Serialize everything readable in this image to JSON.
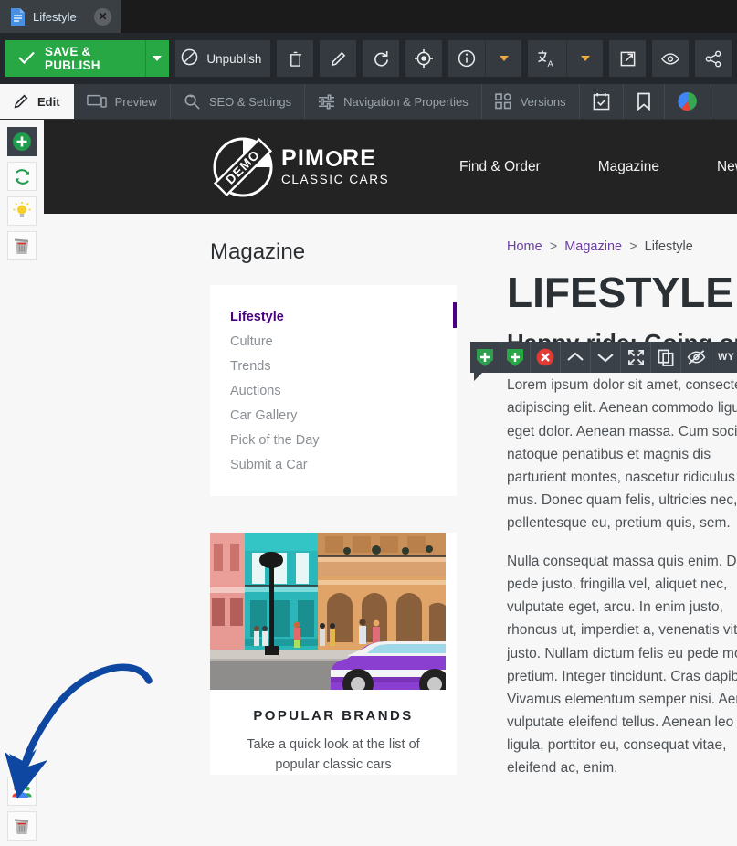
{
  "window": {
    "tab": {
      "label": "Lifestyle",
      "icon": "document-icon",
      "close_icon": "close-icon"
    }
  },
  "toolbar": {
    "save_label": "SAVE & PUBLISH",
    "save_dropdown_icon": "chevron-down-icon",
    "unpublish_label": "Unpublish",
    "buttons": [
      {
        "name": "delete-button",
        "icon": "trash-icon"
      },
      {
        "name": "rename-button",
        "icon": "pencil-icon"
      },
      {
        "name": "reload-button",
        "icon": "refresh-icon"
      },
      {
        "name": "locate-button",
        "icon": "target-icon"
      },
      {
        "name": "info-button",
        "icon": "info-icon"
      },
      {
        "name": "info-dropdown-button",
        "icon": "caret-down-icon"
      },
      {
        "name": "translate-button",
        "icon": "translate-icon"
      },
      {
        "name": "translate-dropdown-button",
        "icon": "caret-down-icon"
      },
      {
        "name": "open-in-new-window-button",
        "icon": "external-link-icon"
      },
      {
        "name": "preview-button",
        "icon": "eye-icon"
      },
      {
        "name": "share-button",
        "icon": "share-icon"
      }
    ]
  },
  "tabs": [
    {
      "label": "Edit",
      "icon": "pencil-icon",
      "active": true
    },
    {
      "label": "Preview",
      "icon": "devices-icon",
      "active": false
    },
    {
      "label": "SEO & Settings",
      "icon": "search-settings-icon",
      "active": false
    },
    {
      "label": "Navigation & Properties",
      "icon": "sliders-icon",
      "active": false
    },
    {
      "label": "Versions",
      "icon": "grid-icon",
      "active": false
    },
    {
      "label": "",
      "icon": "calendar-check-icon",
      "active": false
    },
    {
      "label": "",
      "icon": "bookmark-icon",
      "active": false
    },
    {
      "label": "",
      "icon": "pie-chart-icon",
      "active": false
    }
  ],
  "rail": {
    "top_items": [
      {
        "name": "add-element-button",
        "icon": "plus-circle-icon",
        "state": "dark"
      },
      {
        "name": "reload-element-button",
        "icon": "refresh-green-icon",
        "state": "light"
      },
      {
        "name": "hint-button",
        "icon": "lightbulb-icon",
        "state": "light"
      },
      {
        "name": "delete-element-button",
        "icon": "trash-grey-icon",
        "state": "light"
      }
    ],
    "bottom_items": [
      {
        "name": "user-group-button",
        "icon": "people-icon",
        "state": "light"
      },
      {
        "name": "delete-block-button",
        "icon": "trash-grey-icon",
        "state": "light"
      }
    ]
  },
  "annotation": {
    "arrow_color": "#0d47a1",
    "target": "user-group-button"
  },
  "site": {
    "logo": {
      "badge": "DEMO",
      "brand": "PIMCORE",
      "brand_pre": "PIM",
      "brand_post": "RE",
      "sub": "CLASSIC CARS"
    },
    "nav": [
      {
        "label": "Find & Order"
      },
      {
        "label": "Magazine"
      },
      {
        "label": "News"
      }
    ],
    "magazine": {
      "title": "Magazine",
      "links": [
        {
          "label": "Lifestyle",
          "active": true
        },
        {
          "label": "Culture",
          "active": false
        },
        {
          "label": "Trends",
          "active": false
        },
        {
          "label": "Auctions",
          "active": false
        },
        {
          "label": "Car Gallery",
          "active": false
        },
        {
          "label": "Pick of the Day",
          "active": false
        },
        {
          "label": "Submit a Car",
          "active": false
        }
      ]
    },
    "promo_card": {
      "image_alt": "havana-street-classic-car-photo",
      "title": "POPULAR BRANDS",
      "text": "Take a quick look at the list of popular classic cars"
    },
    "breadcrumb": {
      "home": "Home",
      "magazine": "Magazine",
      "current": "Lifestyle",
      "separator": ">"
    },
    "heading": "LIFESTYLE",
    "subheading": "Happy ride: Going on a",
    "paragraph_1": "Lorem ipsum dolor sit amet, consectetuer adipiscing elit. Aenean commodo ligula eget dolor. Aenean massa. Cum sociis natoque penatibus et magnis dis parturient montes, nascetur ridiculus mus. Donec quam felis, ultricies nec, pellentesque eu, pretium quis, sem.",
    "paragraph_2": "Nulla consequat massa quis enim. Donec pede justo, fringilla vel, aliquet nec, vulputate eget, arcu. In enim justo, rhoncus ut, imperdiet a, venenatis vitae, justo. Nullam dictum felis eu pede mollis pretium. Integer tincidunt. Cras dapibus. Vivamus elementum semper nisi. Aenean vulputate eleifend tellus. Aenean leo ligula, porttitor eu, consequat vitae, eleifend ac, enim."
  },
  "edit_toolbar": {
    "items": [
      {
        "name": "add-block-before-button",
        "icon": "plus-shield-green-icon"
      },
      {
        "name": "add-block-after-button",
        "icon": "plus-shield-dark-green-icon"
      },
      {
        "name": "remove-block-button",
        "icon": "close-circle-red-icon"
      },
      {
        "name": "move-up-button",
        "icon": "chevron-up-icon"
      },
      {
        "name": "move-down-button",
        "icon": "chevron-down-icon"
      },
      {
        "name": "expand-button",
        "icon": "fullscreen-icon"
      },
      {
        "name": "copy-button",
        "icon": "copy-icon"
      },
      {
        "name": "hide-button",
        "icon": "eye-off-icon"
      },
      {
        "name": "wysiwyg-button",
        "icon": "wysiwyg-label",
        "label": "WY"
      }
    ]
  },
  "colors": {
    "accent_green": "#28a745",
    "accent_purple": "#4b0082",
    "link_purple": "#6b3fa0",
    "toolbar_bg": "#24282c",
    "arrow_blue": "#0d47a1"
  }
}
